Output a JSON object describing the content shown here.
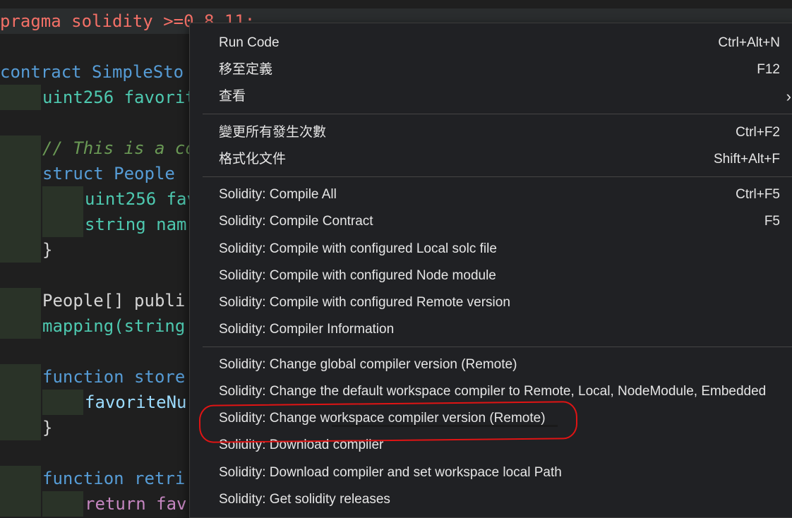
{
  "code": {
    "lines": [
      {
        "text": "pragma solidity >=0.8.11;"
      },
      {
        "text": "contract SimpleSto"
      },
      {
        "text": "uint256 favorit"
      },
      {
        "text": "// This is a co"
      },
      {
        "text": "struct People"
      },
      {
        "text": "uint256 fav"
      },
      {
        "text": "string nam"
      },
      {
        "text": "}"
      },
      {
        "text": "People[] publi"
      },
      {
        "text": "mapping(string"
      },
      {
        "text": "function store"
      },
      {
        "text": "favoriteNu"
      },
      {
        "text": "}"
      },
      {
        "text": "function retri"
      },
      {
        "text": "return fav"
      }
    ]
  },
  "menu": {
    "items": [
      {
        "label": "Run Code",
        "shortcut": "Ctrl+Alt+N"
      },
      {
        "label": "移至定義",
        "shortcut": "F12"
      },
      {
        "label": "查看",
        "shortcut": "",
        "submenu": true
      },
      {
        "label": "變更所有發生次數",
        "shortcut": "Ctrl+F2"
      },
      {
        "label": "格式化文件",
        "shortcut": "Shift+Alt+F"
      },
      {
        "label": "Solidity: Compile All",
        "shortcut": "Ctrl+F5"
      },
      {
        "label": "Solidity: Compile Contract",
        "shortcut": "F5"
      },
      {
        "label": "Solidity: Compile with configured Local solc file",
        "shortcut": ""
      },
      {
        "label": "Solidity: Compile with configured Node module",
        "shortcut": ""
      },
      {
        "label": "Solidity: Compile with configured Remote version",
        "shortcut": ""
      },
      {
        "label": "Solidity: Compiler Information",
        "shortcut": ""
      },
      {
        "label": "Solidity: Change global compiler version (Remote)",
        "shortcut": ""
      },
      {
        "label": "Solidity: Change the default workspace compiler to Remote, Local, NodeModule, Embedded",
        "shortcut": ""
      },
      {
        "label": "Solidity: Change workspace compiler version (Remote)",
        "shortcut": ""
      },
      {
        "label": "Solidity: Download compiler",
        "shortcut": ""
      },
      {
        "label": "Solidity: Download compiler and set workspace local Path",
        "shortcut": ""
      },
      {
        "label": "Solidity: Get solidity releases",
        "shortcut": ""
      }
    ],
    "submenu_icon": "chevron-right-icon",
    "annotation_color": "#e01414"
  }
}
